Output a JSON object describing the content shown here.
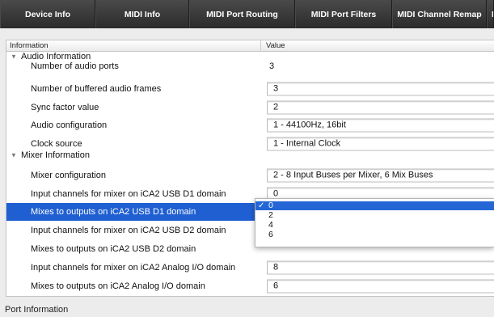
{
  "tabs": [
    {
      "label": "Device Info"
    },
    {
      "label": "MIDI Info"
    },
    {
      "label": "MIDI Port Routing"
    },
    {
      "label": "MIDI Port Filters"
    },
    {
      "label": "MIDI Channel Remap"
    },
    {
      "label": "N"
    }
  ],
  "table": {
    "headers": {
      "information": "Information",
      "value": "Value"
    },
    "rows": [
      {
        "type": "group",
        "label": "Audio Information"
      },
      {
        "type": "item",
        "label": "Number of audio ports",
        "value": "3",
        "kind": "text"
      },
      {
        "type": "item",
        "label": "Number of buffered audio frames",
        "value": "3",
        "kind": "field"
      },
      {
        "type": "item",
        "label": "Sync factor value",
        "value": "2",
        "kind": "field"
      },
      {
        "type": "item",
        "label": "Audio configuration",
        "value": "1 - 44100Hz, 16bit",
        "kind": "field"
      },
      {
        "type": "item",
        "label": "Clock source",
        "value": "1 - Internal Clock",
        "kind": "field"
      },
      {
        "type": "group",
        "label": "Mixer Information"
      },
      {
        "type": "item",
        "label": "Mixer configuration",
        "value": "2 - 8 Input Buses per Mixer, 6 Mix Buses",
        "kind": "field"
      },
      {
        "type": "item",
        "label": "Input channels for mixer on iCA2 USB D1 domain",
        "value": "0",
        "kind": "field"
      },
      {
        "type": "item",
        "label": "Mixes to outputs on iCA2 USB D1 domain",
        "value": "",
        "kind": "none",
        "selected": true
      },
      {
        "type": "item",
        "label": "Input channels for mixer on iCA2 USB D2 domain",
        "value": "",
        "kind": "none"
      },
      {
        "type": "item",
        "label": "Mixes to outputs on iCA2 USB D2 domain",
        "value": "",
        "kind": "none"
      },
      {
        "type": "item",
        "label": "Input channels for mixer on iCA2 Analog I/O domain",
        "value": "8",
        "kind": "field"
      },
      {
        "type": "item",
        "label": "Mixes to outputs on iCA2 Analog I/O domain",
        "value": "6",
        "kind": "field"
      }
    ]
  },
  "dropdown": {
    "options": [
      "0",
      "2",
      "4",
      "6"
    ],
    "selected": "0",
    "check_glyph": "✓"
  },
  "footer": {
    "label": "Port Information"
  },
  "colors": {
    "selection": "#1f5fd1",
    "toolbar": "#2e2e2e"
  }
}
